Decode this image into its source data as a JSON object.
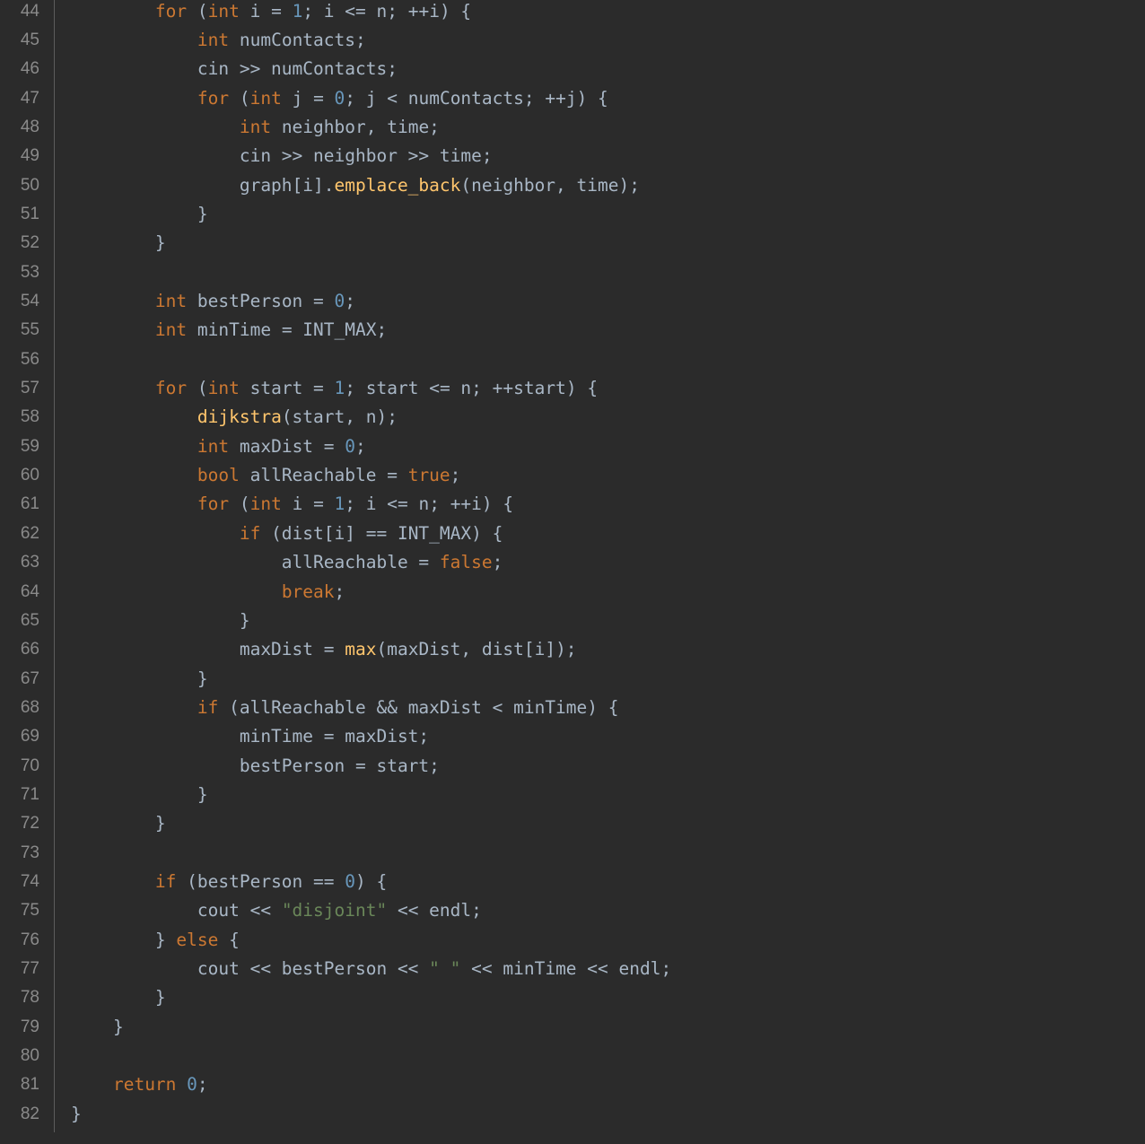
{
  "theme": {
    "background": "#2b2b2b",
    "gutter_text": "#8a8a8a",
    "plain": "#a9b7c6",
    "keyword": "#cc7832",
    "number": "#6897bb",
    "function": "#ffc66d",
    "string": "#6a8759"
  },
  "lines": [
    {
      "n": "44",
      "tokens": [
        [
          "pl",
          "        "
        ],
        [
          "kw",
          "for"
        ],
        [
          "pl",
          " ("
        ],
        [
          "kw",
          "int"
        ],
        [
          "pl",
          " i = "
        ],
        [
          "num",
          "1"
        ],
        [
          "pl",
          "; i <= n; ++i) {"
        ]
      ]
    },
    {
      "n": "45",
      "tokens": [
        [
          "pl",
          "            "
        ],
        [
          "kw",
          "int"
        ],
        [
          "pl",
          " numContacts;"
        ]
      ]
    },
    {
      "n": "46",
      "tokens": [
        [
          "pl",
          "            cin >> numContacts;"
        ]
      ]
    },
    {
      "n": "47",
      "tokens": [
        [
          "pl",
          "            "
        ],
        [
          "kw",
          "for"
        ],
        [
          "pl",
          " ("
        ],
        [
          "kw",
          "int"
        ],
        [
          "pl",
          " j = "
        ],
        [
          "num",
          "0"
        ],
        [
          "pl",
          "; j < numContacts; ++j) {"
        ]
      ]
    },
    {
      "n": "48",
      "tokens": [
        [
          "pl",
          "                "
        ],
        [
          "kw",
          "int"
        ],
        [
          "pl",
          " neighbor, time;"
        ]
      ]
    },
    {
      "n": "49",
      "tokens": [
        [
          "pl",
          "                cin >> neighbor >> time;"
        ]
      ]
    },
    {
      "n": "50",
      "tokens": [
        [
          "pl",
          "                graph[i]."
        ],
        [
          "fn",
          "emplace_back"
        ],
        [
          "pl",
          "(neighbor, time);"
        ]
      ]
    },
    {
      "n": "51",
      "tokens": [
        [
          "pl",
          "            }"
        ]
      ]
    },
    {
      "n": "52",
      "tokens": [
        [
          "pl",
          "        }"
        ]
      ]
    },
    {
      "n": "53",
      "tokens": []
    },
    {
      "n": "54",
      "tokens": [
        [
          "pl",
          "        "
        ],
        [
          "kw",
          "int"
        ],
        [
          "pl",
          " bestPerson = "
        ],
        [
          "num",
          "0"
        ],
        [
          "pl",
          ";"
        ]
      ]
    },
    {
      "n": "55",
      "tokens": [
        [
          "pl",
          "        "
        ],
        [
          "kw",
          "int"
        ],
        [
          "pl",
          " minTime = INT_MAX;"
        ]
      ]
    },
    {
      "n": "56",
      "tokens": []
    },
    {
      "n": "57",
      "tokens": [
        [
          "pl",
          "        "
        ],
        [
          "kw",
          "for"
        ],
        [
          "pl",
          " ("
        ],
        [
          "kw",
          "int"
        ],
        [
          "pl",
          " start = "
        ],
        [
          "num",
          "1"
        ],
        [
          "pl",
          "; start <= n; ++start) {"
        ]
      ]
    },
    {
      "n": "58",
      "tokens": [
        [
          "pl",
          "            "
        ],
        [
          "fn",
          "dijkstra"
        ],
        [
          "pl",
          "(start, n);"
        ]
      ]
    },
    {
      "n": "59",
      "tokens": [
        [
          "pl",
          "            "
        ],
        [
          "kw",
          "int"
        ],
        [
          "pl",
          " maxDist = "
        ],
        [
          "num",
          "0"
        ],
        [
          "pl",
          ";"
        ]
      ]
    },
    {
      "n": "60",
      "tokens": [
        [
          "pl",
          "            "
        ],
        [
          "kw",
          "bool"
        ],
        [
          "pl",
          " allReachable = "
        ],
        [
          "kw",
          "true"
        ],
        [
          "pl",
          ";"
        ]
      ]
    },
    {
      "n": "61",
      "tokens": [
        [
          "pl",
          "            "
        ],
        [
          "kw",
          "for"
        ],
        [
          "pl",
          " ("
        ],
        [
          "kw",
          "int"
        ],
        [
          "pl",
          " i = "
        ],
        [
          "num",
          "1"
        ],
        [
          "pl",
          "; i <= n; ++i) {"
        ]
      ]
    },
    {
      "n": "62",
      "tokens": [
        [
          "pl",
          "                "
        ],
        [
          "kw",
          "if"
        ],
        [
          "pl",
          " (dist[i] == INT_MAX) {"
        ]
      ]
    },
    {
      "n": "63",
      "tokens": [
        [
          "pl",
          "                    allReachable = "
        ],
        [
          "kw",
          "false"
        ],
        [
          "pl",
          ";"
        ]
      ]
    },
    {
      "n": "64",
      "tokens": [
        [
          "pl",
          "                    "
        ],
        [
          "kw",
          "break"
        ],
        [
          "pl",
          ";"
        ]
      ]
    },
    {
      "n": "65",
      "tokens": [
        [
          "pl",
          "                }"
        ]
      ]
    },
    {
      "n": "66",
      "tokens": [
        [
          "pl",
          "                maxDist = "
        ],
        [
          "fn",
          "max"
        ],
        [
          "pl",
          "(maxDist, dist[i]);"
        ]
      ]
    },
    {
      "n": "67",
      "tokens": [
        [
          "pl",
          "            }"
        ]
      ]
    },
    {
      "n": "68",
      "tokens": [
        [
          "pl",
          "            "
        ],
        [
          "kw",
          "if"
        ],
        [
          "pl",
          " (allReachable && maxDist < minTime) {"
        ]
      ]
    },
    {
      "n": "69",
      "tokens": [
        [
          "pl",
          "                minTime = maxDist;"
        ]
      ]
    },
    {
      "n": "70",
      "tokens": [
        [
          "pl",
          "                bestPerson = start;"
        ]
      ]
    },
    {
      "n": "71",
      "tokens": [
        [
          "pl",
          "            }"
        ]
      ]
    },
    {
      "n": "72",
      "tokens": [
        [
          "pl",
          "        }"
        ]
      ]
    },
    {
      "n": "73",
      "tokens": []
    },
    {
      "n": "74",
      "tokens": [
        [
          "pl",
          "        "
        ],
        [
          "kw",
          "if"
        ],
        [
          "pl",
          " (bestPerson == "
        ],
        [
          "num",
          "0"
        ],
        [
          "pl",
          ") {"
        ]
      ]
    },
    {
      "n": "75",
      "tokens": [
        [
          "pl",
          "            cout << "
        ],
        [
          "str",
          "\"disjoint\""
        ],
        [
          "pl",
          " << endl;"
        ]
      ]
    },
    {
      "n": "76",
      "tokens": [
        [
          "pl",
          "        } "
        ],
        [
          "kw",
          "else"
        ],
        [
          "pl",
          " {"
        ]
      ]
    },
    {
      "n": "77",
      "tokens": [
        [
          "pl",
          "            cout << bestPerson << "
        ],
        [
          "str",
          "\" \""
        ],
        [
          "pl",
          " << minTime << endl;"
        ]
      ]
    },
    {
      "n": "78",
      "tokens": [
        [
          "pl",
          "        }"
        ]
      ]
    },
    {
      "n": "79",
      "tokens": [
        [
          "pl",
          "    }"
        ]
      ]
    },
    {
      "n": "80",
      "tokens": []
    },
    {
      "n": "81",
      "tokens": [
        [
          "pl",
          "    "
        ],
        [
          "kw",
          "return"
        ],
        [
          "pl",
          " "
        ],
        [
          "num",
          "0"
        ],
        [
          "pl",
          ";"
        ]
      ]
    },
    {
      "n": "82",
      "tokens": [
        [
          "pl",
          "}"
        ]
      ]
    }
  ]
}
